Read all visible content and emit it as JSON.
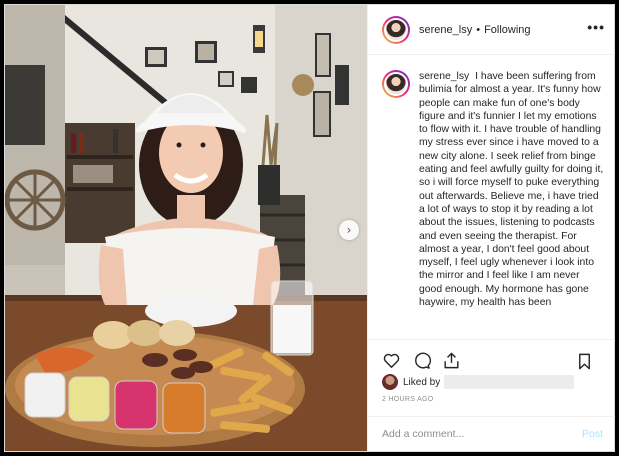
{
  "post": {
    "username": "serene_lsy",
    "separator": "•",
    "follow_status": "Following",
    "more_label": "•••",
    "caption": "I have been suffering from bulimia for almost a year. It's funny how people can make fun of one's body figure and it's funnier I let my emotions to flow with it. I have trouble of handling my stress ever since i have moved to a new city alone. I seek relief from binge eating and feel awfully guilty for doing it, so i will force myself to puke everything out afterwards. Believe me, i have tried a lot of ways to stop it by reading a lot about the issues, listening to podcasts and even seeing the therapist. For almost a year, I don't feel good about myself, I feel ugly whenever i look into the mirror and I feel like I am never good enough. My hormone has gone haywire, my health has been",
    "liked_by_label": "Liked by",
    "timestamp": "2 HOURS AGO",
    "carousel_next": "›"
  },
  "comment": {
    "placeholder": "Add a comment...",
    "post_label": "Post"
  },
  "icons": {
    "like": "heart-icon",
    "comment": "comment-icon",
    "share": "share-icon",
    "save": "bookmark-icon",
    "next": "chevron-right-icon"
  },
  "colors": {
    "post_link": "#b2dffc",
    "muted_text": "#8e8e8e",
    "story_ring_start": "#f9ce34",
    "story_ring_end": "#6228d7"
  }
}
